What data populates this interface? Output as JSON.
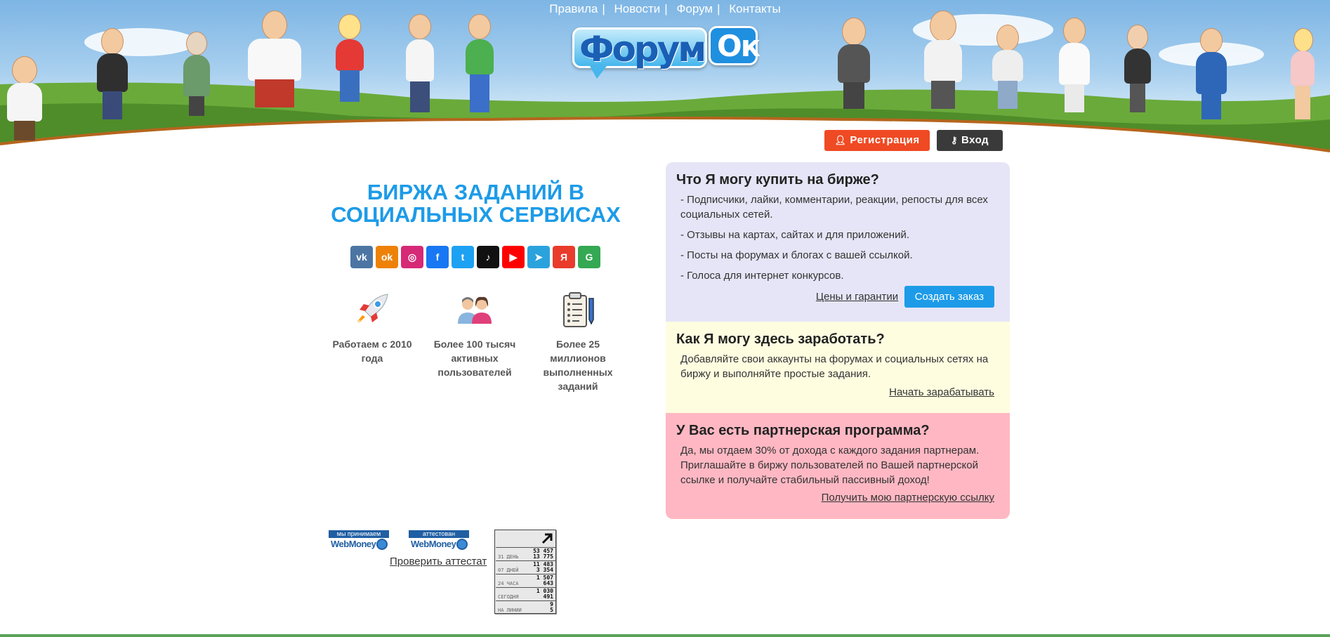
{
  "nav": {
    "items": [
      {
        "label": "Правила"
      },
      {
        "label": "Новости"
      },
      {
        "label": "Форум"
      },
      {
        "label": "Контакты"
      }
    ],
    "separator": "|"
  },
  "logo": {
    "part1": "Форум",
    "part2": "Ок"
  },
  "auth": {
    "register_label": "Регистрация",
    "login_label": "Вход"
  },
  "hero": {
    "title_line1": "БИРЖА ЗАДАНИЙ В",
    "title_line2": "СОЦИАЛЬНЫХ СЕРВИСАХ"
  },
  "socials": [
    {
      "name": "vk-icon",
      "glyph": "vk",
      "color": "#4c75a3"
    },
    {
      "name": "odnoklassniki-icon",
      "glyph": "ok",
      "color": "#ee8208"
    },
    {
      "name": "instagram-icon",
      "glyph": "◎",
      "color": "#d62976"
    },
    {
      "name": "facebook-icon",
      "glyph": "f",
      "color": "#1877f2"
    },
    {
      "name": "twitter-icon",
      "glyph": "t",
      "color": "#1da1f2"
    },
    {
      "name": "tiktok-icon",
      "glyph": "♪",
      "color": "#111111"
    },
    {
      "name": "youtube-icon",
      "glyph": "▶",
      "color": "#ff0000"
    },
    {
      "name": "telegram-icon",
      "glyph": "➤",
      "color": "#2aa3dd"
    },
    {
      "name": "yandex-icon",
      "glyph": "Я",
      "color": "#e93c2c"
    },
    {
      "name": "google-maps-icon",
      "glyph": "G",
      "color": "#34a853"
    }
  ],
  "features": [
    {
      "icon": "rocket-icon",
      "text": "Работаем с 2010 года"
    },
    {
      "icon": "users-icon",
      "text": "Более 100 тысяч активных пользователей"
    },
    {
      "icon": "clipboard-icon",
      "text": "Более 25 миллионов выполненных заданий"
    }
  ],
  "panel_buy": {
    "title": "Что Я могу купить на бирже?",
    "items": [
      "- Подписчики, лайки, комментарии, реакции, репосты для всех социальных сетей.",
      "- Отзывы на картах, сайтах и для приложений.",
      "- Посты на форумах и блогах с вашей ссылкой.",
      "- Голоса для интернет конкурсов."
    ],
    "prices_link": "Цены и гарантии",
    "order_button": "Создать заказ",
    "bg_color": "#e5e5f7"
  },
  "panel_earn": {
    "title": "Как Я могу здесь заработать?",
    "text": "Добавляйте свои аккаунты на форумах и социальных сетях на биржу и выполняйте простые задания.",
    "link": "Начать зарабатывать",
    "bg_color": "#fffde0"
  },
  "panel_partner": {
    "title": "У Вас есть партнерская программа?",
    "text": "Да, мы отдаем 30% от дохода с каждого задания партнерам. Приглашайте в биржу пользователей по Вашей партнерской ссылке и получайте стабильный пассивный доход!",
    "link": "Получить мою партнерскую ссылку",
    "bg_color": "#ffb8c3"
  },
  "footer": {
    "wm_accept_band": "мы принимаем",
    "wm_attest_band": "аттестован",
    "wm_name": "WebMoney",
    "check_cert": "Проверить аттестат",
    "counter": [
      {
        "label": "31 ДЕНЬ",
        "v1": "53 457",
        "v2": "13 775"
      },
      {
        "label": "07 ДНЕЙ",
        "v1": "11 483",
        "v2": "3 354"
      },
      {
        "label": "24 ЧАСА",
        "v1": "1 507",
        "v2": "643"
      },
      {
        "label": "СЕГОДНЯ",
        "v1": "1 030",
        "v2": "491"
      },
      {
        "label": "НА ЛИНИИ",
        "v1": "9",
        "v2": "5"
      }
    ]
  },
  "colors": {
    "accent_blue": "#1d9be8",
    "register_red": "#ef4a23",
    "login_dark": "#3a3a3a",
    "footer_green": "#5aa25a"
  }
}
